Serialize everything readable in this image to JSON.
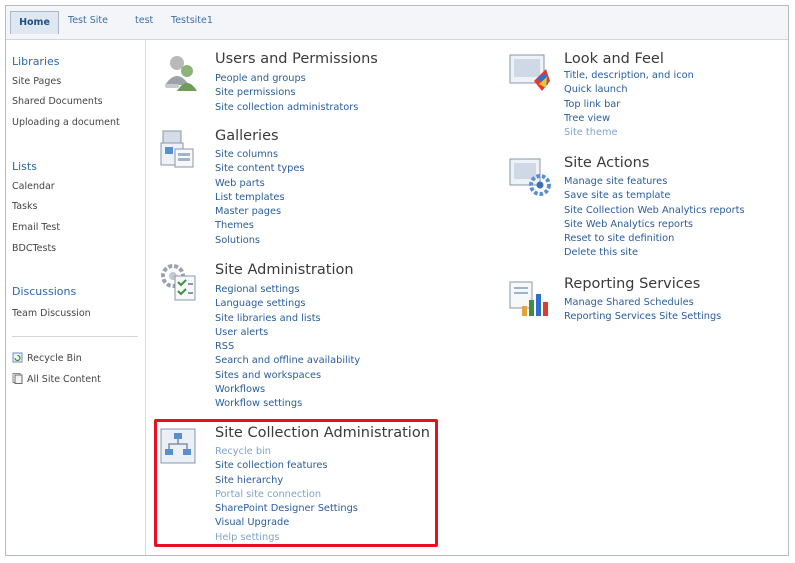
{
  "topnav": {
    "tabs": [
      "Home",
      "Test Site",
      "test",
      "Testsite1"
    ]
  },
  "quicklaunch": {
    "libraries": {
      "heading": "Libraries",
      "items": [
        "Site Pages",
        "Shared Documents",
        "Uploading a document"
      ]
    },
    "lists": {
      "heading": "Lists",
      "items": [
        "Calendar",
        "Tasks",
        "Email Test",
        "BDCTests"
      ]
    },
    "discussions": {
      "heading": "Discussions",
      "items": [
        "Team Discussion"
      ]
    },
    "recycle_bin": "Recycle Bin",
    "all_site_content": "All Site Content"
  },
  "sections": {
    "users": {
      "title": "Users and Permissions",
      "icon": "users-icon",
      "links": [
        "People and groups",
        "Site permissions",
        "Site collection administrators"
      ]
    },
    "galleries": {
      "title": "Galleries",
      "icon": "galleries-icon",
      "links": [
        "Site columns",
        "Site content types",
        "Web parts",
        "List templates",
        "Master pages",
        "Themes",
        "Solutions"
      ]
    },
    "site_admin": {
      "title": "Site Administration",
      "icon": "site-admin-icon",
      "links": [
        "Regional settings",
        "Language settings",
        "Site libraries and lists",
        "User alerts",
        "RSS",
        "Search and offline availability",
        "Sites and workspaces",
        "Workflows",
        "Workflow settings"
      ]
    },
    "site_collection_admin": {
      "title": "Site Collection Administration",
      "icon": "site-collection-icon",
      "links": [
        "Recycle bin",
        "Site collection features",
        "Site hierarchy",
        "Portal site connection",
        "SharePoint Designer Settings",
        "Visual Upgrade",
        "Help settings"
      ]
    },
    "look_feel": {
      "title": "Look and Feel",
      "icon": "look-feel-icon",
      "links": [
        "Title, description, and icon",
        "Quick launch",
        "Top link bar",
        "Tree view",
        "Site theme"
      ]
    },
    "site_actions": {
      "title": "Site Actions",
      "icon": "site-actions-icon",
      "links": [
        "Manage site features",
        "Save site as template",
        "Site Collection Web Analytics reports",
        "Site Web Analytics reports",
        "Reset to site definition",
        "Delete this site"
      ]
    },
    "reporting": {
      "title": "Reporting Services",
      "icon": "reporting-icon",
      "links": [
        "Manage Shared Schedules",
        "Reporting Services Site Settings"
      ]
    }
  },
  "colors": {
    "link": "#2a5d9c",
    "highlight_border": "#e8101e",
    "quicklaunch_heading": "#2c66aa"
  }
}
